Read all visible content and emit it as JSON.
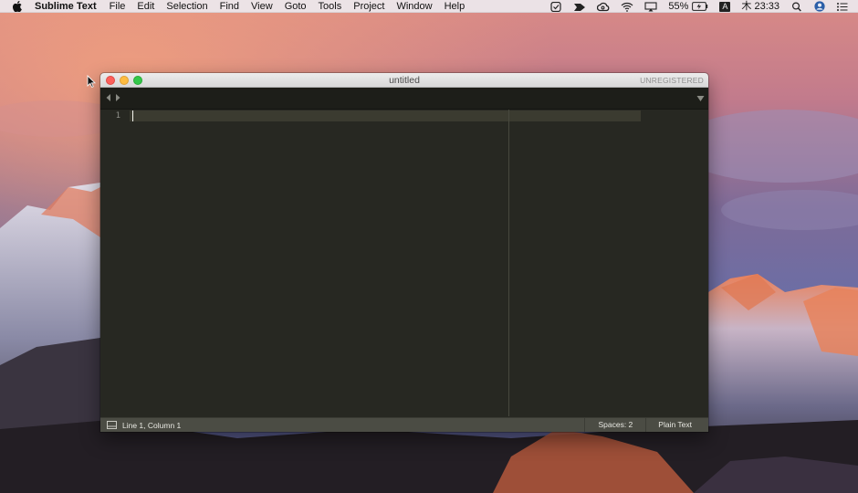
{
  "menubar": {
    "app_name": "Sublime Text",
    "items": [
      "File",
      "Edit",
      "Selection",
      "Find",
      "View",
      "Goto",
      "Tools",
      "Project",
      "Window",
      "Help"
    ],
    "battery": "55%",
    "input_source": "A",
    "clock": "木 23:33",
    "icons": [
      "apple-icon",
      "checkbox-icon",
      "bird-icon",
      "creative-cloud-icon",
      "wifi-icon",
      "airplay-icon",
      "battery-icon",
      "input-source-icon",
      "search-icon",
      "user-icon",
      "list-icon"
    ]
  },
  "window": {
    "title": "untitled",
    "license_label": "UNREGISTERED",
    "tabbar_icons": [
      "nav-left-icon",
      "nav-right-icon",
      "tab-dropdown-icon"
    ]
  },
  "editor": {
    "line_numbers": [
      "1"
    ],
    "content": ""
  },
  "statusbar": {
    "position": "Line 1, Column 1",
    "indentation": "Spaces: 2",
    "syntax": "Plain Text"
  },
  "colors": {
    "editor_bg": "#272822",
    "tabbar_bg": "#1d1e19",
    "statusbar_bg": "#4b4c44",
    "line_number": "#8f908a",
    "current_line": "#3e3d32"
  }
}
